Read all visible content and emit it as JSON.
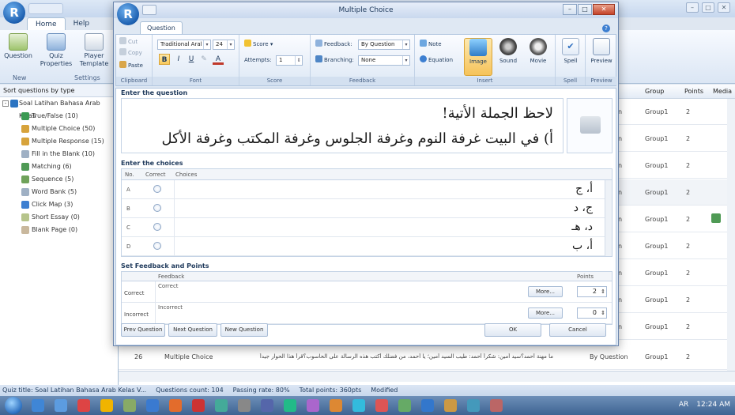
{
  "background_app": {
    "tabs": [
      "Home",
      "Help"
    ],
    "ribbon": {
      "buttons": [
        "Question",
        "Quiz Properties",
        "Player Template"
      ],
      "groups": [
        "New",
        "Settings"
      ]
    },
    "left_panel": {
      "header": "Sort questions by type",
      "root": "Soal Latihan Bahasa Arab Kelas",
      "items": [
        {
          "label": "True/False  (10)",
          "color": "#3b9a53"
        },
        {
          "label": "Multiple Choice  (50)",
          "color": "#d7a33b"
        },
        {
          "label": "Multiple Response  (15)",
          "color": "#d7a33b"
        },
        {
          "label": "Fill in the Blank  (10)",
          "color": "#9fb0c4"
        },
        {
          "label": "Matching  (6)",
          "color": "#4f9a55"
        },
        {
          "label": "Sequence  (5)",
          "color": "#6fa25a"
        },
        {
          "label": "Word Bank  (5)",
          "color": "#9fb0c4"
        },
        {
          "label": "Click Map  (3)",
          "color": "#3d7fd1"
        },
        {
          "label": "Short Essay  (0)",
          "color": "#b6c48b"
        },
        {
          "label": "Blank Page  (0)",
          "color": "#c9b89d"
        }
      ]
    },
    "grid": {
      "headers": {
        "group": "Group",
        "points": "Points",
        "media": "Media"
      },
      "rows": [
        {
          "suffix": "n",
          "group": "Group1",
          "points": "2"
        },
        {
          "suffix": "n",
          "group": "Group1",
          "points": "2"
        },
        {
          "suffix": "n",
          "group": "Group1",
          "points": "2"
        },
        {
          "suffix": "n",
          "group": "Group1",
          "points": "2"
        },
        {
          "suffix": "n",
          "group": "Group1",
          "points": "2"
        },
        {
          "suffix": "n",
          "group": "Group1",
          "points": "2"
        },
        {
          "suffix": "n",
          "group": "Group1",
          "points": "2"
        },
        {
          "suffix": "n",
          "group": "Group1",
          "points": "2"
        },
        {
          "suffix": "n",
          "group": "Group1",
          "points": "2"
        }
      ],
      "row26": {
        "num": "26",
        "type": "Multiple Choice",
        "text": "ما مهنة أحمد؟سيد أمين: شكراً أحمد: طيب السيد أمين؛ يا أحمد، من فضلك أكتب هذه الرسالة على الحاسوب؟قرأ هذا الحوار جيداً",
        "feedback": "By Question",
        "group": "Group1",
        "points": "2"
      }
    },
    "status": {
      "title": "Quiz title: Soal Latihan Bahasa Arab Kelas V...",
      "count": "Questions count: 104",
      "passing": "Passing rate: 80%",
      "points": "Total points: 360pts",
      "modified": "Modified"
    },
    "tray": {
      "lang": "AR",
      "time": "12:24 AM"
    }
  },
  "dialog": {
    "title": "Multiple Choice",
    "tab": "Question",
    "ribbon": {
      "clipboard": {
        "cut": "Cut",
        "copy": "Copy",
        "paste": "Paste",
        "label": "Clipboard"
      },
      "font": {
        "family": "Traditional Aral",
        "size": "24",
        "bold": "B",
        "italic": "I",
        "underline": "U",
        "label": "Font"
      },
      "score": {
        "score_label": "Score",
        "attempts_label": "Attempts:",
        "attempts_value": "1",
        "label": "Score"
      },
      "feedback": {
        "feedback_label": "Feedback:",
        "feedback_value": "By Question",
        "branching_label": "Branching:",
        "branching_value": "None",
        "label": "Feedback"
      },
      "insert": {
        "note": "Note",
        "equation": "Equation",
        "image": "Image",
        "sound": "Sound",
        "movie": "Movie",
        "label": "Insert"
      },
      "spell": {
        "button": "Spell",
        "label": "Spell"
      },
      "preview": {
        "button": "Preview",
        "label": "Preview"
      }
    },
    "question_section": "Enter the question",
    "question_line1": "لاحظ الجملة الأتية!",
    "question_line2": "أ) في البيت غرفة النوم وغرفة الجلوس وغرفة المكتب وغرفة الأكل",
    "choices_section": "Enter the choices",
    "choices_header": {
      "no": "No.",
      "correct": "Correct",
      "choices": "Choices"
    },
    "choices": [
      {
        "no": "A",
        "text": "أ، ج"
      },
      {
        "no": "B",
        "text": "ج، د"
      },
      {
        "no": "C",
        "text": "د، هـ"
      },
      {
        "no": "D",
        "text": "أ، ب"
      }
    ],
    "feedback_section": "Set Feedback and Points",
    "feedback_header": {
      "feedback": "Feedback",
      "points": "Points"
    },
    "feedback_rows": [
      {
        "label": "Correct",
        "text": "Correct",
        "more": "More...",
        "points": "2"
      },
      {
        "label": "Incorrect",
        "text": "Incorrect",
        "more": "More...",
        "points": "0"
      }
    ],
    "buttons": {
      "prev": "Prev Question",
      "next": "Next Question",
      "new": "New Question",
      "ok": "OK",
      "cancel": "Cancel"
    }
  }
}
